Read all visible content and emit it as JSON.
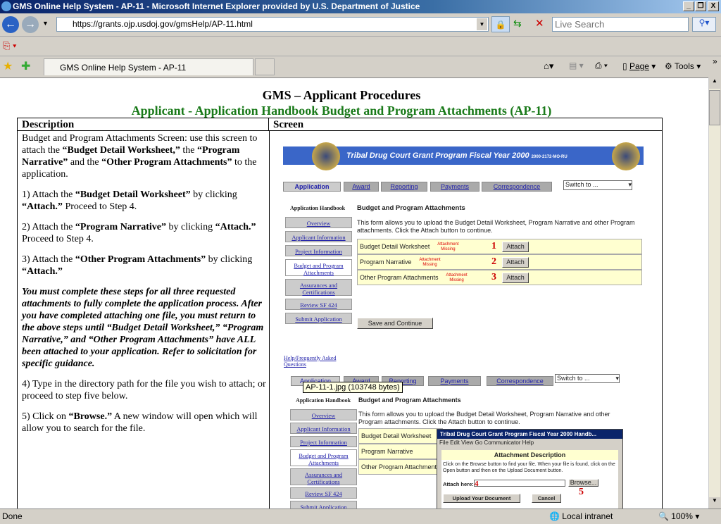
{
  "window": {
    "title": "GMS Online Help System - AP-11 - Microsoft Internet Explorer provided by U.S. Department of Justice",
    "min": "_",
    "max": "❐",
    "close": "X"
  },
  "address": {
    "url": "https://grants.ojp.usdoj.gov/gmsHelp/AP-11.html",
    "search_placeholder": "Live Search"
  },
  "tabs": [
    {
      "label": "GMS Online Help System - AP-11"
    }
  ],
  "toolbar": {
    "page": "Page",
    "tools": "Tools",
    "more": "»"
  },
  "page": {
    "title": "GMS – Applicant Procedures",
    "subtitle": "Applicant - Application Handbook Budget and Program Attachments (AP-11)",
    "col_description": "Description",
    "col_screen": "Screen",
    "intro_a": "Budget and Program Attachments Screen: use this screen to attach the ",
    "intro_b": "“Budget Detail Worksheet,”",
    "intro_c": " the ",
    "intro_d": "“Program Narrative”",
    "intro_e": " and the ",
    "intro_f": "“Other Program Attachments”",
    "intro_g": " to the application.",
    "s1a": "1) Attach the ",
    "s1b": "“Budget Detail Worksheet”",
    "s1c": " by clicking ",
    "s1d": "“Attach.”",
    "s1e": "  Proceed to Step 4.",
    "s2a": "2) Attach the ",
    "s2b": "“Program Narrative”",
    "s2c": " by clicking ",
    "s2d": "“Attach.”",
    "s2e": "  Proceed to Step 4.",
    "s3a": "3) Attach the ",
    "s3b": "“Other Program Attachments”",
    "s3c": " by clicking ",
    "s3d": "“Attach.”",
    "note": "You must complete these steps for all three requested attachments to fully complete the application process.  After you have completed attaching one file, you must return to the above steps until “Budget Detail Worksheet,” “Program Narrative,” and “Other Program Attachments” have ALL been attached to your application.  Refer to solicitation for specific guidance.",
    "s4": "4) Type in the directory path for the file you wish to attach; or proceed to step five below.",
    "s5a": "5) Click on ",
    "s5b": "“Browse.”",
    "s5c": "  A new window will open which will allow you to search for the file."
  },
  "screen": {
    "banner": "Tribal Drug Court Grant Program Fiscal Year 2000",
    "banner_code": "2000-2172-MO-RU",
    "tabs": [
      "Application",
      "Award",
      "Reporting",
      "Payments",
      "Correspondence"
    ],
    "switch": "Switch to ...",
    "handbook": "Application Handbook",
    "nav": [
      "Overview",
      "Applicant Information",
      "Project Information",
      "Budget and Program Attachments",
      "Assurances and Certifications",
      "Review SF 424",
      "Submit Application"
    ],
    "heading": "Budget and Program Attachments",
    "intro": "This form allows you to upload the Budget Detail Worksheet, Program Narrative and other Program attachments. Click the Attach button to continue.",
    "rows": [
      {
        "label": "Budget Detail Worksheet",
        "num": "1"
      },
      {
        "label": "Program Narrative",
        "num": "2"
      },
      {
        "label": "Other Program Attachments",
        "num": "3"
      }
    ],
    "missing": "Attachment Missing",
    "attach": "Attach",
    "save": "Save and Continue",
    "help": "Help/Frequently Asked Questions",
    "tooltip": "AP-11-1.jpg (103748 bytes)",
    "popup": {
      "title": "Tribal Drug Court Grant Program Fiscal Year 2000 Handb...",
      "menu": [
        "File",
        "Edit",
        "View",
        "Go",
        "Communicator",
        "Help"
      ],
      "heading": "Attachment Description",
      "text": "Click on the Browse button to find your file. When your file is found, click on the Open button and then on the Upload Document button.",
      "attach_label": "Attach here:",
      "num4": "4",
      "browse": "Browse...",
      "num5": "5",
      "upload": "Upload Your Document",
      "cancel": "Cancel"
    }
  },
  "status": {
    "left": "Done",
    "zone": "Local intranet",
    "zoom": "100%"
  }
}
